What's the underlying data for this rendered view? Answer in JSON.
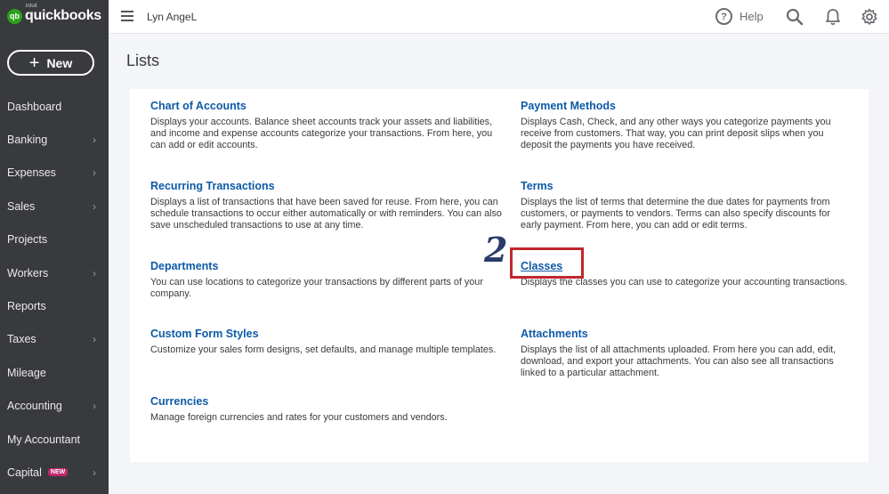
{
  "sidebar": {
    "logo_intuit": "intuit",
    "logo_name": "quickbooks",
    "new_label": "New",
    "items": [
      {
        "label": "Dashboard",
        "chevron": false
      },
      {
        "label": "Banking",
        "chevron": true
      },
      {
        "label": "Expenses",
        "chevron": true
      },
      {
        "label": "Sales",
        "chevron": true
      },
      {
        "label": "Projects",
        "chevron": false
      },
      {
        "label": "Workers",
        "chevron": true
      },
      {
        "label": "Reports",
        "chevron": false
      },
      {
        "label": "Taxes",
        "chevron": true
      },
      {
        "label": "Mileage",
        "chevron": false
      },
      {
        "label": "Accounting",
        "chevron": true
      },
      {
        "label": "My Accountant",
        "chevron": false
      },
      {
        "label": "Capital",
        "chevron": true,
        "badge": "NEW"
      }
    ]
  },
  "topbar": {
    "company_name": "Lyn AngeL",
    "help_label": "Help",
    "icons": [
      "menu-icon",
      "help-icon",
      "search-icon",
      "bell-icon",
      "gear-icon"
    ]
  },
  "main": {
    "title": "Lists",
    "left_column": [
      {
        "title": "Chart of Accounts",
        "desc": "Displays your accounts. Balance sheet accounts track your assets and liabilities, and income and expense accounts categorize your transactions. From here, you can add or edit accounts."
      },
      {
        "title": "Recurring Transactions",
        "desc": "Displays a list of transactions that have been saved for reuse. From here, you can schedule transactions to occur either automatically or with reminders. You can also save unscheduled transactions to use at any time."
      },
      {
        "title": "Departments",
        "desc": "You can use locations to categorize your transactions by different parts of your company."
      },
      {
        "title": "Custom Form Styles",
        "desc": "Customize your sales form designs, set defaults, and manage multiple templates."
      },
      {
        "title": "Currencies",
        "desc": "Manage foreign currencies and rates for your customers and vendors."
      }
    ],
    "right_column": [
      {
        "title": "Payment Methods",
        "desc": "Displays Cash, Check, and any other ways you categorize payments you receive from customers. That way, you can print deposit slips when you deposit the payments you have received."
      },
      {
        "title": "Terms",
        "desc": "Displays the list of terms that determine the due dates for payments from customers, or payments to vendors. Terms can also specify discounts for early payment. From here, you can add or edit terms."
      },
      {
        "title": "Classes",
        "desc": "Displays the classes you can use to categorize your accounting transactions."
      },
      {
        "title": "Attachments",
        "desc": "Displays the list of all attachments uploaded. From here you can add, edit, download, and export your attachments. You can also see all transactions linked to a particular attachment."
      }
    ]
  },
  "annotation": {
    "step_number": "2",
    "highlight_color": "#c0272d"
  },
  "colors": {
    "sidebar_bg": "#393a3d",
    "link_blue": "#0d5aa7",
    "brand_green": "#2ca01c",
    "badge_pink": "#c0286e"
  }
}
